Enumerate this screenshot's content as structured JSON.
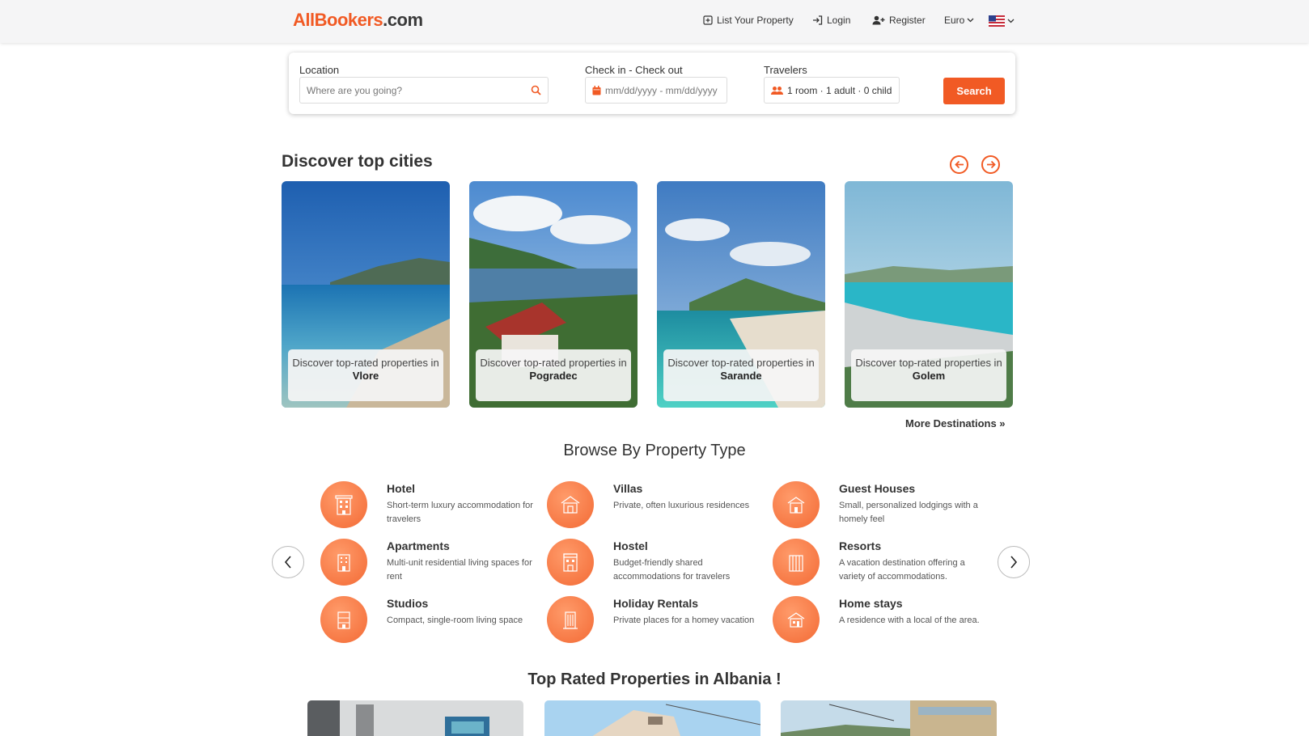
{
  "header": {
    "logo_part1": "AllBookers",
    "logo_part2": ".com",
    "list_property": "List Your Property",
    "login": "Login",
    "register": "Register",
    "currency": "Euro",
    "language_flag": "us-flag-icon"
  },
  "search": {
    "location_label": "Location",
    "location_placeholder": "Where are you going?",
    "dates_label": "Check in - Check out",
    "dates_placeholder": "mm/dd/yyyy - mm/dd/yyyy",
    "travelers_label": "Travelers",
    "travelers_value": "1 room · 1 adult · 0 child",
    "button": "Search"
  },
  "cities": {
    "title": "Discover top cities",
    "caption": "Discover top-rated properties in",
    "items": [
      {
        "name": "Vlore"
      },
      {
        "name": "Pogradec"
      },
      {
        "name": "Sarande"
      },
      {
        "name": "Golem"
      }
    ],
    "more": "More Destinations »"
  },
  "property_types": {
    "title": "Browse By Property Type",
    "items": [
      {
        "name": "Hotel",
        "desc": "Short-term luxury accommodation for travelers"
      },
      {
        "name": "Villas",
        "desc": "Private, often luxurious residences"
      },
      {
        "name": "Guest Houses",
        "desc": "Small, personalized lodgings with a homely feel"
      },
      {
        "name": "Apartments",
        "desc": "Multi-unit residential living spaces for rent"
      },
      {
        "name": "Hostel",
        "desc": "Budget-friendly shared accommodations for travelers"
      },
      {
        "name": "Resorts",
        "desc": "A vacation destination offering a variety of accommodations."
      },
      {
        "name": "Studios",
        "desc": "Compact, single-room living space"
      },
      {
        "name": "Holiday Rentals",
        "desc": "Private places for a homey vacation"
      },
      {
        "name": "Home stays",
        "desc": "A residence with a local of the area."
      }
    ]
  },
  "top_rated": {
    "title": "Top Rated Properties in Albania !"
  },
  "colors": {
    "brand": "#f15a24"
  }
}
